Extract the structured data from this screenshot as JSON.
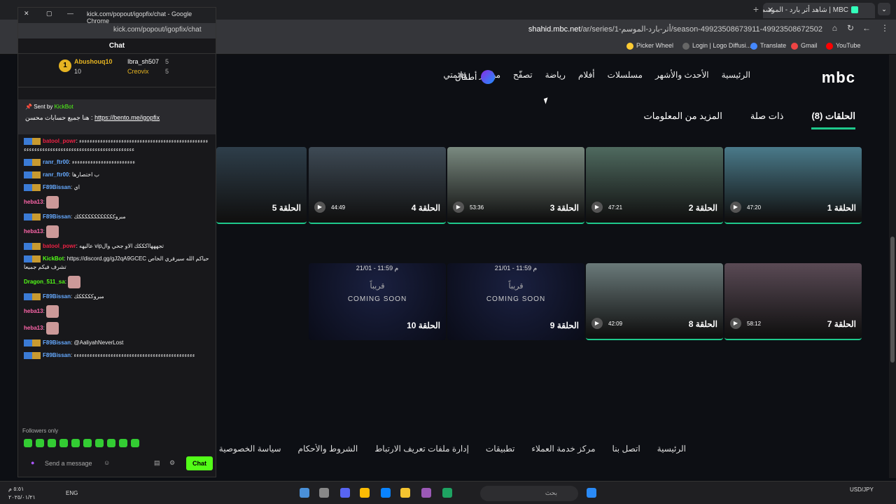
{
  "browser": {
    "tab_title": "MBC | شاهد أثر بارد - الموسم 1",
    "url_domain": "shahid.mbc.net",
    "url_path": "/ar/series/أثر-بارد-الموسم-1/season-49923508673911-49923508672502"
  },
  "bookmarks": [
    "Picker Wheel",
    "Login | Logo Diffusi...",
    "Translate",
    "Gmail",
    "YouTube"
  ],
  "site": {
    "logo": "mbc",
    "menu": [
      "الرئيسية",
      "الأحدث والأشهر",
      "مسلسلات",
      "أفلام",
      "رياضة",
      "تصفّح",
      "مباشر",
      "قائمتي"
    ],
    "kids": "أطفال"
  },
  "tabs": [
    "الحلقات (8)",
    "ذات صلة",
    "المزيد من المعلومات"
  ],
  "episodes": [
    {
      "title": "الحلقة 1",
      "duration": "47:20",
      "color": "#4a7a8a"
    },
    {
      "title": "الحلقة 2",
      "duration": "47:21",
      "color": "#4f6a5f"
    },
    {
      "title": "الحلقة 3",
      "duration": "53:36",
      "color": "#7a8a80"
    },
    {
      "title": "الحلقة 4",
      "duration": "44:49",
      "color": "#3e4a55"
    },
    {
      "title": "الحلقة 5",
      "duration": "",
      "color": "#2e3e4a"
    },
    {
      "title": "الحلقة 7",
      "duration": "58:12",
      "color": "#5a4a55"
    },
    {
      "title": "الحلقة 8",
      "duration": "42:09",
      "color": "#6a7a7a"
    }
  ],
  "upcoming": [
    {
      "title": "الحلقة 9",
      "date": "21/01 - 11:59 م",
      "ar": "قريباً",
      "en": "COMING SOON"
    },
    {
      "title": "الحلقة 10",
      "date": "21/01 - 11:59 م",
      "ar": "قريباً",
      "en": "COMING SOON"
    }
  ],
  "footer": [
    "الرئيسية",
    "اتصل بنا",
    "مركز خدمة العملاء",
    "تطبيقات",
    "إدارة ملفات تعريف الارتباط",
    "الشروط والأحكام",
    "سياسة الخصوصية"
  ],
  "popup": {
    "window_title": "kick.com/popout/igopfix/chat - Google Chrome",
    "url": "kick.com/popout/igopfix/chat",
    "header": "Chat",
    "podium": {
      "first_name": "Abushouq10",
      "first_count": "10",
      "second_name": "Ibra_sh507",
      "second_count": "5",
      "third_name": "Creovix",
      "third_count": "5"
    },
    "pinned": {
      "sent_by": "Sent by",
      "bot": "KickBot",
      "text": "هنا جميع حسابات محسن :",
      "link": "https://bento.me/igopfix"
    },
    "messages": [
      {
        "user": "batool_powr",
        "color": "#e24",
        "text": "ءءءءءءءءءءءءءءءءءءءءءءءءءءءءءءءءءءءءءءءءءءءءءءءءءءءءءءءءءءءءءءءءءءءءءءءءءءءءءءءءءءءءءءءءءءء"
      },
      {
        "user": "ranr_ftr00",
        "color": "#6af",
        "text": "ءءءءءءءءءءءءءءءءءءءءءءءء"
      },
      {
        "user": "ranr_ftr00",
        "color": "#6af",
        "text": "ب اختصارها"
      },
      {
        "user": "F89Bissan",
        "color": "#6af",
        "text": "اي"
      },
      {
        "user": "heba13",
        "color": "#f6a",
        "text": ""
      },
      {
        "user": "F89Bissan",
        "color": "#6af",
        "text": "مبروككككككككككككك"
      },
      {
        "user": "heba13",
        "color": "#f6a",
        "text": ""
      },
      {
        "user": "batool_powr",
        "color": "#e24",
        "text": "عاليهه vipتجهههااكككك الاو جحي وال"
      },
      {
        "user": "KickBot",
        "color": "#53fc18",
        "text": "https://discord.gg/gJ2qA9GCEC حياكم الله سيرفري الخاص تشرف فيكم جميعا"
      },
      {
        "user": "Dragon_511_sa",
        "color": "#53fc18",
        "text": ""
      },
      {
        "user": "F89Bissan",
        "color": "#6af",
        "text": "مبروكككككك"
      },
      {
        "user": "heba13",
        "color": "#f6a",
        "text": ""
      },
      {
        "user": "heba13",
        "color": "#f6a",
        "text": ""
      },
      {
        "user": "F89Bissan",
        "color": "#6af",
        "text": "@AaliyahNeverLost"
      },
      {
        "user": "F89Bissan",
        "color": "#6af",
        "text": "ءءءءءءءءءءءءءءءءءءءءءءءءءءءءءءءءءءءءءءءءءءءءءء"
      }
    ],
    "followers_only": "Followers only",
    "placeholder": "Send a message",
    "send": "Chat"
  },
  "taskbar": {
    "time": "٥:٥١ م",
    "date": "٢٠٢٥/٠١/٢١",
    "lang": "ENG",
    "currency": "USD/JPY",
    "search": "بحث"
  }
}
